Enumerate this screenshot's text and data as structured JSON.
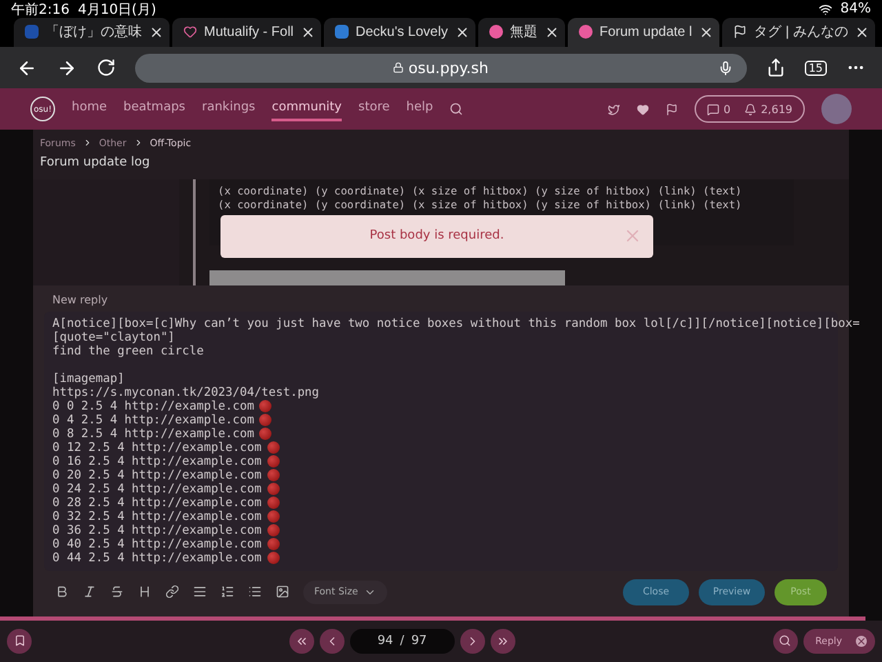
{
  "status_bar": {
    "time": "午前2:16",
    "date": "4月10日(月)",
    "battery": "84%"
  },
  "tabs": [
    {
      "label": "「ぼけ」の意味",
      "selected": false
    },
    {
      "label": "Mutualify - Foll",
      "selected": false
    },
    {
      "label": "Decku's Lovely",
      "selected": false
    },
    {
      "label": "無題",
      "selected": false
    },
    {
      "label": "Forum update l",
      "selected": true
    },
    {
      "label": "タグ | みんなの",
      "selected": false
    }
  ],
  "address_bar": {
    "url": "osu.ppy.sh",
    "tab_count": "15"
  },
  "nav": {
    "logo": "osu!",
    "items": [
      {
        "label": "home",
        "selected": false
      },
      {
        "label": "beatmaps",
        "selected": false
      },
      {
        "label": "rankings",
        "selected": false
      },
      {
        "label": "community",
        "selected": true
      },
      {
        "label": "store",
        "selected": false
      },
      {
        "label": "help",
        "selected": false
      }
    ],
    "chat_count": "0",
    "notification_count": "2,619"
  },
  "breadcrumb": [
    "Forums",
    "Other",
    "Off-Topic"
  ],
  "topic_title": "Forum update log",
  "code_lines": [
    "(x coordinate) (y coordinate) (x size of hitbox) (y size of hitbox) (link) (text)",
    "(x coordinate) (y coordinate) (x size of hitbox) (y size of hitbox) (link) (text)"
  ],
  "notice": {
    "message": "Post body is required."
  },
  "reply": {
    "heading": "New reply",
    "lines": [
      {
        "text": "A[notice][box=[c]Why can’t you just have two notice boxes without this random box lol[/c]][/notice][notice][box=",
        "dot": false
      },
      {
        "text": "[quote=\"clayton\"]",
        "dot": false
      },
      {
        "text": "find the green circle",
        "dot": false
      },
      {
        "dot": false
      },
      {
        "text": "[imagemap]",
        "dot": false
      },
      {
        "text": "https://s.myconan.tk/2023/04/test.png",
        "dot": false
      },
      {
        "text": "0 0 2.5 4 http://example.com",
        "dot": true
      },
      {
        "text": "0 4 2.5 4 http://example.com",
        "dot": true
      },
      {
        "text": "0 8 2.5 4 http://example.com",
        "dot": true
      },
      {
        "text": "0 12 2.5 4 http://example.com",
        "dot": true
      },
      {
        "text": "0 16 2.5 4 http://example.com",
        "dot": true
      },
      {
        "text": "0 20 2.5 4 http://example.com",
        "dot": true
      },
      {
        "text": "0 24 2.5 4 http://example.com",
        "dot": true
      },
      {
        "text": "0 28 2.5 4 http://example.com",
        "dot": true
      },
      {
        "text": "0 32 2.5 4 http://example.com",
        "dot": true
      },
      {
        "text": "0 36 2.5 4 http://example.com",
        "dot": true
      },
      {
        "text": "0 40 2.5 4 http://example.com",
        "dot": true
      },
      {
        "text": "0 44 2.5 4 http://example.com",
        "dot": true
      }
    ],
    "font_size_label": "Font Size",
    "buttons": [
      {
        "label": "Close",
        "kind": "secondary"
      },
      {
        "label": "Preview",
        "kind": "secondary"
      },
      {
        "label": "Post",
        "kind": "primary"
      }
    ]
  },
  "pager": {
    "current": "94",
    "separator": "/",
    "total": "97"
  },
  "reply_button": "Reply"
}
